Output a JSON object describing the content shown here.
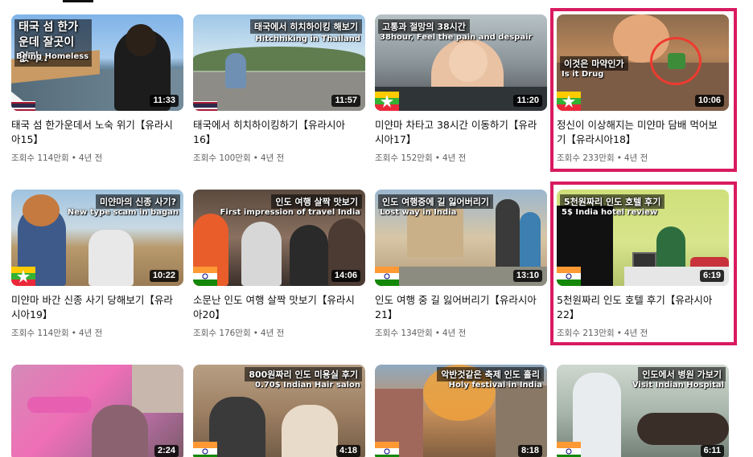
{
  "colors": {
    "highlight": "#d81b60",
    "meta_text": "#606060",
    "duration_bg": "#000000"
  },
  "videos": [
    {
      "overlay": "태국 섬 한가운데 잘곳이 없다..",
      "overlay_sub": "Being Homeless",
      "flag": "thailand",
      "duration": "11:33",
      "title": "태국 섬 한가운데서 노숙 위기【유라시아15】",
      "views": "조회수 114만회",
      "age": "4년 전"
    },
    {
      "overlay": "태국에서 히치하이킹 해보기",
      "overlay_sub": "Hitchhiking in Thailand",
      "flag": "thailand",
      "duration": "11:57",
      "title": "태국에서 히치하이킹하기【유라시아16】",
      "views": "조회수 100만회",
      "age": "4년 전"
    },
    {
      "overlay": "고통과 절망의 38시간",
      "overlay_sub": "38hour, Feel the pain and despair",
      "flag": "myanmar",
      "duration": "11:20",
      "title": "미얀마 차타고 38시간 이동하기【유라시아17】",
      "views": "조회수 152만회",
      "age": "4년 전"
    },
    {
      "overlay": "이것은 마약인가",
      "overlay_sub": "Is it Drug",
      "flag": "myanmar",
      "duration": "10:06",
      "title": "정신이 이상해지는 미얀마 담배 먹어보기【유라시아18】",
      "views": "조회수 233만회",
      "age": "4년 전"
    },
    {
      "overlay": "미얀마의 신종 사기?",
      "overlay_sub": "New type scam in bagan",
      "flag": "myanmar",
      "duration": "10:22",
      "title": "미얀마 바간 신종 사기 당해보기【유라시아19】",
      "views": "조회수 114만회",
      "age": "4년 전"
    },
    {
      "overlay": "인도 여행 살짝 맛보기",
      "overlay_sub": "First impression of travel India",
      "flag": "india",
      "duration": "14:06",
      "title": "소문난 인도 여행 살짝 맛보기【유라시아20】",
      "views": "조회수 176만회",
      "age": "4년 전"
    },
    {
      "overlay": "인도 여행중에 길 잃어버리기",
      "overlay_sub": "Lost way in India",
      "flag": "india",
      "duration": "13:10",
      "title": "인도 여행 중 길 잃어버리기【유라시아21】",
      "views": "조회수 134만회",
      "age": "4년 전"
    },
    {
      "overlay": "5천원짜리 인도 호텔 후기",
      "overlay_sub": "5$ India hotel review",
      "flag": "india",
      "duration": "6:19",
      "title": "5천원짜리 인도 호텔 후기【유라시아22】",
      "views": "조회수 213만회",
      "age": "4년 전"
    },
    {
      "overlay": "",
      "overlay_sub": "",
      "flag": "none",
      "duration": "2:24"
    },
    {
      "overlay": "800원짜리 인도 미용실 후기",
      "overlay_sub": "0.70$ Indian Hair salon",
      "flag": "india",
      "duration": "4:18"
    },
    {
      "overlay": "악반것같은 축제 인도 홀리",
      "overlay_sub": "Holy festival in India",
      "flag": "india",
      "duration": "8:18"
    },
    {
      "overlay": "인도에서 병원 가보기",
      "overlay_sub": "Visit Indian Hospital",
      "flag": "india",
      "duration": "6:11"
    }
  ]
}
